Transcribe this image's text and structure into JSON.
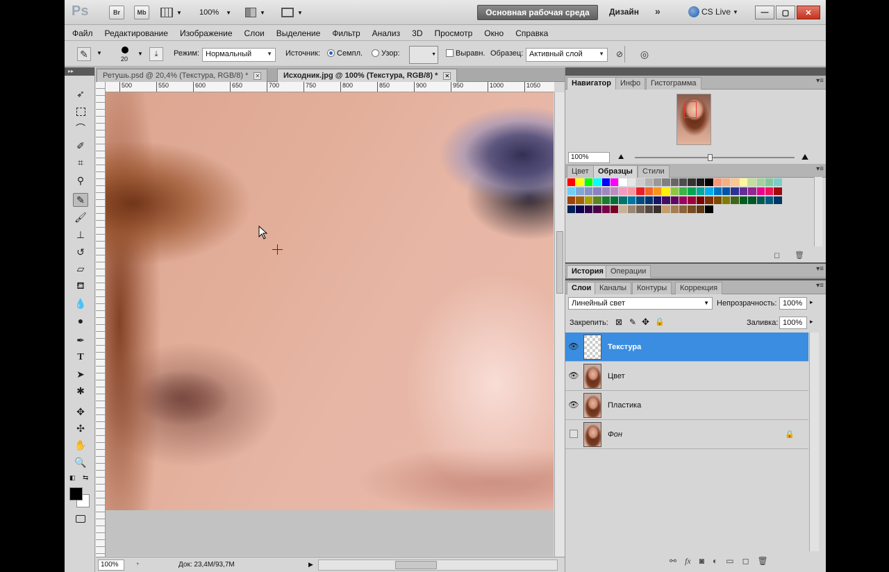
{
  "appbar": {
    "logo": "Ps",
    "buttons": [
      "Br",
      "Mb"
    ],
    "zoom": "100%",
    "workspace": "Основная рабочая среда",
    "design": "Дизайн",
    "more": "»",
    "cslive": "CS Live"
  },
  "menu": [
    "Файл",
    "Редактирование",
    "Изображение",
    "Слои",
    "Выделение",
    "Фильтр",
    "Анализ",
    "3D",
    "Просмотр",
    "Окно",
    "Справка"
  ],
  "options": {
    "brush_size": "20",
    "mode_label": "Режим:",
    "mode_value": "Нормальный",
    "source_label": "Источник:",
    "sampled_label": "Семпл.",
    "pattern_label": "Узор:",
    "aligned_label": "Выравн.",
    "sample_label": "Образец:",
    "sample_value": "Активный слой"
  },
  "tabs": [
    {
      "label": "Ретушь.psd @ 20,4% (Текстура, RGB/8) *"
    },
    {
      "label": "Исходник.jpg @ 100% (Текстура, RGB/8) *"
    }
  ],
  "ruler": [
    "500",
    "550",
    "600",
    "650",
    "700",
    "750",
    "800",
    "850",
    "900",
    "950",
    "1000",
    "1050"
  ],
  "status": {
    "zoom": "100%",
    "doc": "Док: 23,4M/93,7M"
  },
  "navigator": {
    "tabs": [
      "Навигатор",
      "Инфо",
      "Гистограмма"
    ],
    "zoom": "100%"
  },
  "swatch_panel": {
    "tabs": [
      "Цвет",
      "Образцы",
      "Стили"
    ]
  },
  "history_panel": {
    "tabs": [
      "История",
      "Операции"
    ]
  },
  "layers_panel": {
    "tabs": [
      "Слои",
      "Каналы",
      "Контуры",
      "Коррекция"
    ],
    "blend_mode": "Линейный свет",
    "opacity_label": "Непрозрачность:",
    "opacity": "100%",
    "lock_label": "Закрепить:",
    "fill_label": "Заливка:",
    "fill": "100%",
    "layers": [
      {
        "name": "Текстура"
      },
      {
        "name": "Цвет"
      },
      {
        "name": "Пластика"
      },
      {
        "name": "Фон"
      }
    ]
  },
  "colors": {
    "selection": "#3a8de0",
    "swatches": [
      [
        "#ff0000",
        "#ffff00",
        "#00ff00",
        "#00ffff",
        "#0000ff",
        "#ff00ff",
        "#ffffff",
        "#e6e6e6",
        "#cccccc",
        "#b3b3b3",
        "#999999",
        "#808080",
        "#666666",
        "#4d4d4d",
        "#333333",
        "#1a1a1a",
        "#000000",
        "#f7977a",
        "#f9ad81",
        "#fdc68a",
        "#fff79a",
        "#c4df9b",
        "#a3d39c",
        "#82ca9d",
        "#7bcdc8"
      ],
      [
        "#6ecff6",
        "#7ea7d8",
        "#8493ca",
        "#8882be",
        "#a187be",
        "#bc8dbf",
        "#f49ac2",
        "#f6989d",
        "#ed1c24",
        "#f26522",
        "#f7941d",
        "#fff200",
        "#8dc73f",
        "#39b54a",
        "#00a651",
        "#00a99d",
        "#00aeef",
        "#0072bc",
        "#0054a6",
        "#2e3192",
        "#662d91",
        "#92278f",
        "#ec008c",
        "#ed145b",
        "#9e0b0f"
      ],
      [
        "#a0410d",
        "#a36209",
        "#aba000",
        "#598527",
        "#1a7b30",
        "#007236",
        "#00746b",
        "#0076a3",
        "#004b80",
        "#003471",
        "#1b1464",
        "#440e62",
        "#630460",
        "#9e005d",
        "#9e0039",
        "#790000",
        "#7b2e00",
        "#7d4900",
        "#827b00",
        "#406618",
        "#005e20",
        "#005826",
        "#005952",
        "#005b7f",
        "#003663"
      ],
      [
        "#002157",
        "#0d004c",
        "#32004b",
        "#4b0049",
        "#7b0046",
        "#7a0026",
        "#c7b299",
        "#998675",
        "#736357",
        "#534741",
        "#37302d",
        "#c69c6d",
        "#a67c52",
        "#8c6239",
        "#754c24",
        "#603913",
        "#000000"
      ]
    ]
  }
}
